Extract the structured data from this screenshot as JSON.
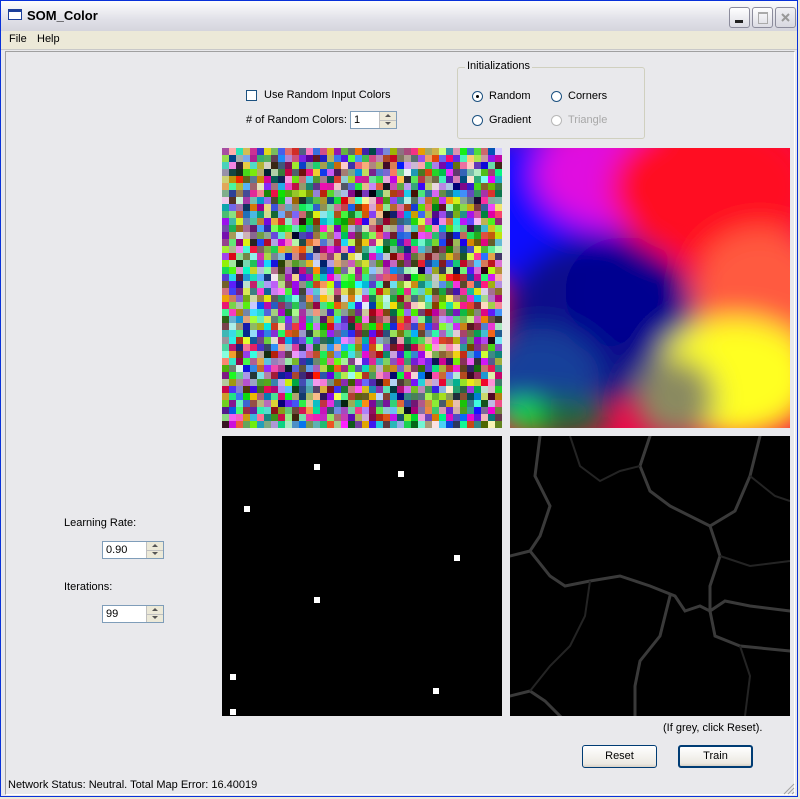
{
  "window": {
    "title": "SOM_Color"
  },
  "menu": {
    "items": [
      "File",
      "Help"
    ]
  },
  "controls": {
    "use_random_label": "Use Random Input Colors",
    "use_random_checked": false,
    "num_random_label": "# of Random Colors:",
    "num_random_value": "1",
    "learning_rate_label": "Learning Rate:",
    "learning_rate_value": "0.90",
    "iterations_label": "Iterations:",
    "iterations_value": "99"
  },
  "initializations": {
    "caption": "Initializations",
    "options": [
      {
        "label": "Random",
        "selected": true,
        "enabled": true
      },
      {
        "label": "Corners",
        "selected": false,
        "enabled": true
      },
      {
        "label": "Gradient",
        "selected": false,
        "enabled": true
      },
      {
        "label": "Triangle",
        "selected": false,
        "enabled": false
      }
    ]
  },
  "panels": {
    "input_noise": "random-color-grid",
    "trained_map": "self-organized-color-map",
    "winner_nodes": "winner-node-markers",
    "umatrix": "distance-map"
  },
  "hint": "(If grey, click Reset).",
  "buttons": {
    "reset": "Reset",
    "train": "Train"
  },
  "status": "Network Status: Neutral. Total Map Error: 16.40019",
  "colors": {
    "window_bg": "#e9e9ec",
    "border_blue": "#0831d9",
    "panel_bg": "#000000"
  }
}
